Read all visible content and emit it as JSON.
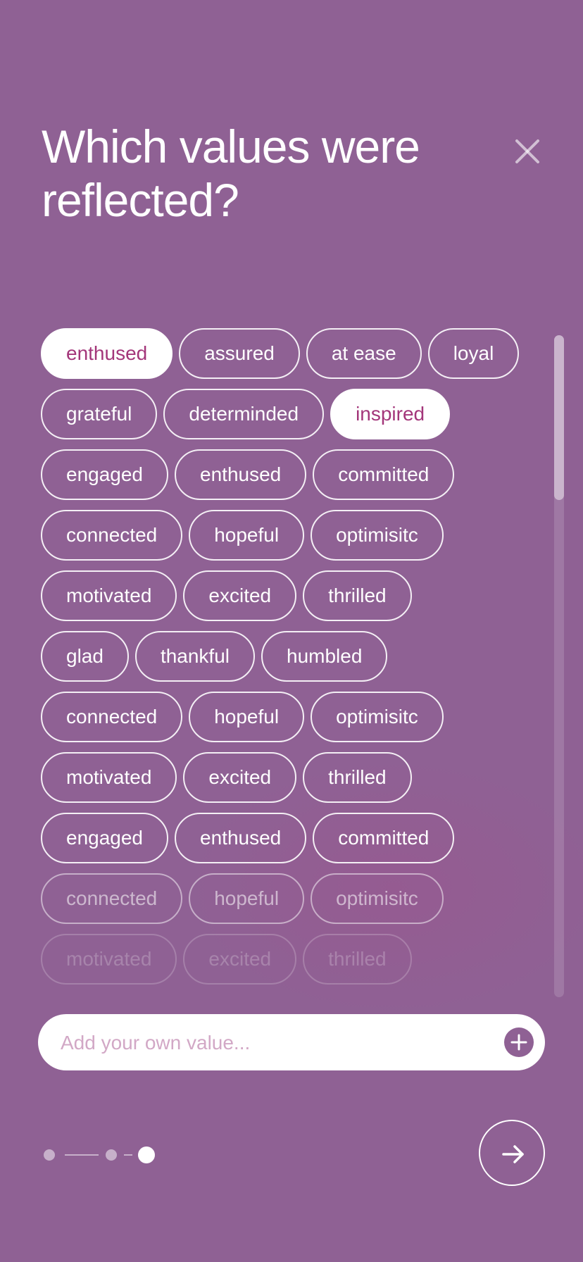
{
  "title": "Which values were reflected?",
  "close_icon": "close-icon",
  "chip_rows": [
    [
      {
        "label": "enthused",
        "selected": true
      },
      {
        "label": "assured",
        "selected": false
      },
      {
        "label": "at ease",
        "selected": false
      },
      {
        "label": "loyal",
        "selected": false
      }
    ],
    [
      {
        "label": "grateful",
        "selected": false
      },
      {
        "label": "determinded",
        "selected": false
      },
      {
        "label": "inspired",
        "selected": true
      }
    ],
    [
      {
        "label": "engaged",
        "selected": false
      },
      {
        "label": "enthused",
        "selected": false
      },
      {
        "label": "committed",
        "selected": false
      }
    ],
    [
      {
        "label": "connected",
        "selected": false
      },
      {
        "label": "hopeful",
        "selected": false
      },
      {
        "label": "optimisitc",
        "selected": false
      }
    ],
    [
      {
        "label": "motivated",
        "selected": false
      },
      {
        "label": "excited",
        "selected": false
      },
      {
        "label": "thrilled",
        "selected": false
      }
    ],
    [
      {
        "label": "glad",
        "selected": false
      },
      {
        "label": "thankful",
        "selected": false
      },
      {
        "label": "humbled",
        "selected": false
      }
    ],
    [
      {
        "label": "connected",
        "selected": false
      },
      {
        "label": "hopeful",
        "selected": false
      },
      {
        "label": "optimisitc",
        "selected": false
      }
    ],
    [
      {
        "label": "motivated",
        "selected": false
      },
      {
        "label": "excited",
        "selected": false
      },
      {
        "label": "thrilled",
        "selected": false
      }
    ],
    [
      {
        "label": "engaged",
        "selected": false
      },
      {
        "label": "enthused",
        "selected": false
      },
      {
        "label": "committed",
        "selected": false
      }
    ],
    [
      {
        "label": "connected",
        "selected": false
      },
      {
        "label": "hopeful",
        "selected": false
      },
      {
        "label": "optimisitc",
        "selected": false
      }
    ],
    [
      {
        "label": "motivated",
        "selected": false
      },
      {
        "label": "excited",
        "selected": false
      },
      {
        "label": "thrilled",
        "selected": false
      }
    ]
  ],
  "add_value": {
    "value": "",
    "placeholder": "Add your own value...",
    "button_icon": "plus-icon"
  },
  "progress": {
    "total_steps": 3,
    "current_step": 3
  },
  "next_button_icon": "arrow-right-icon",
  "colors": {
    "background": "#8f6194",
    "accent": "#a3367a",
    "chip_border": "#ffffff",
    "placeholder": "#d2a8c6"
  }
}
